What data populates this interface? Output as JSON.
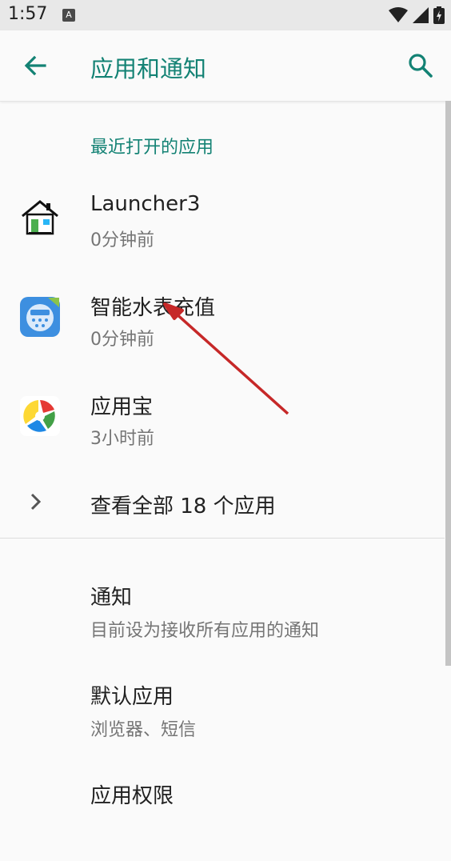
{
  "status_bar": {
    "time": "1:57",
    "notif_icon_letter": "A"
  },
  "header": {
    "title": "应用和通知"
  },
  "recent": {
    "section_title": "最近打开的应用",
    "apps": [
      {
        "name": "Launcher3",
        "time": "0分钟前"
      },
      {
        "name": "智能水表充值",
        "time": "0分钟前"
      },
      {
        "name": "应用宝",
        "time": "3小时前"
      }
    ],
    "see_all": "查看全部 18 个应用"
  },
  "settings": [
    {
      "title": "通知",
      "summary": "目前设为接收所有应用的通知"
    },
    {
      "title": "默认应用",
      "summary": "浏览器、短信"
    },
    {
      "title": "应用权限"
    }
  ],
  "colors": {
    "accent": "#138274",
    "annotation_arrow": "#c62828"
  }
}
